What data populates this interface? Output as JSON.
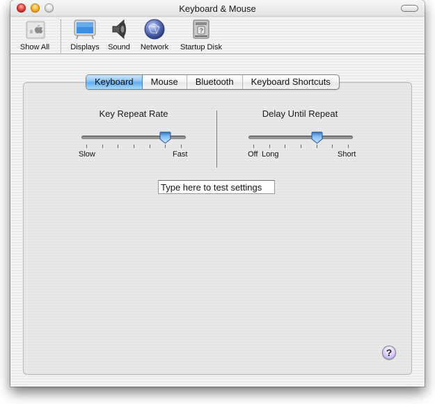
{
  "window": {
    "title": "Keyboard & Mouse",
    "buttons": [
      "close",
      "minimize",
      "zoom"
    ],
    "toolbar_toggle": "toolbar-pill"
  },
  "toolbar": {
    "items": [
      {
        "label": "Show All",
        "icon": "show-all-icon"
      },
      {
        "label": "Displays",
        "icon": "displays-icon"
      },
      {
        "label": "Sound",
        "icon": "sound-icon"
      },
      {
        "label": "Network",
        "icon": "network-icon"
      },
      {
        "label": "Startup Disk",
        "icon": "startup-disk-icon"
      }
    ]
  },
  "tabs": [
    {
      "label": "Keyboard",
      "active": true
    },
    {
      "label": "Mouse",
      "active": false
    },
    {
      "label": "Bluetooth",
      "active": false
    },
    {
      "label": "Keyboard Shortcuts",
      "active": false
    }
  ],
  "keyboard": {
    "key_repeat": {
      "title": "Key Repeat Rate",
      "min_label": "Slow",
      "max_label": "Fast",
      "tick_count": 7,
      "value_index": 5
    },
    "delay_until_repeat": {
      "title": "Delay Until Repeat",
      "off_label": "Off",
      "min_label": "Long",
      "max_label": "Short",
      "tick_count": 7,
      "value_index": 4
    },
    "test_field": {
      "value": "Type here to test settings"
    }
  },
  "help": {
    "label": "?"
  },
  "colors": {
    "accent_tab": "#63a8ec",
    "help_button": "#b59ae8"
  }
}
